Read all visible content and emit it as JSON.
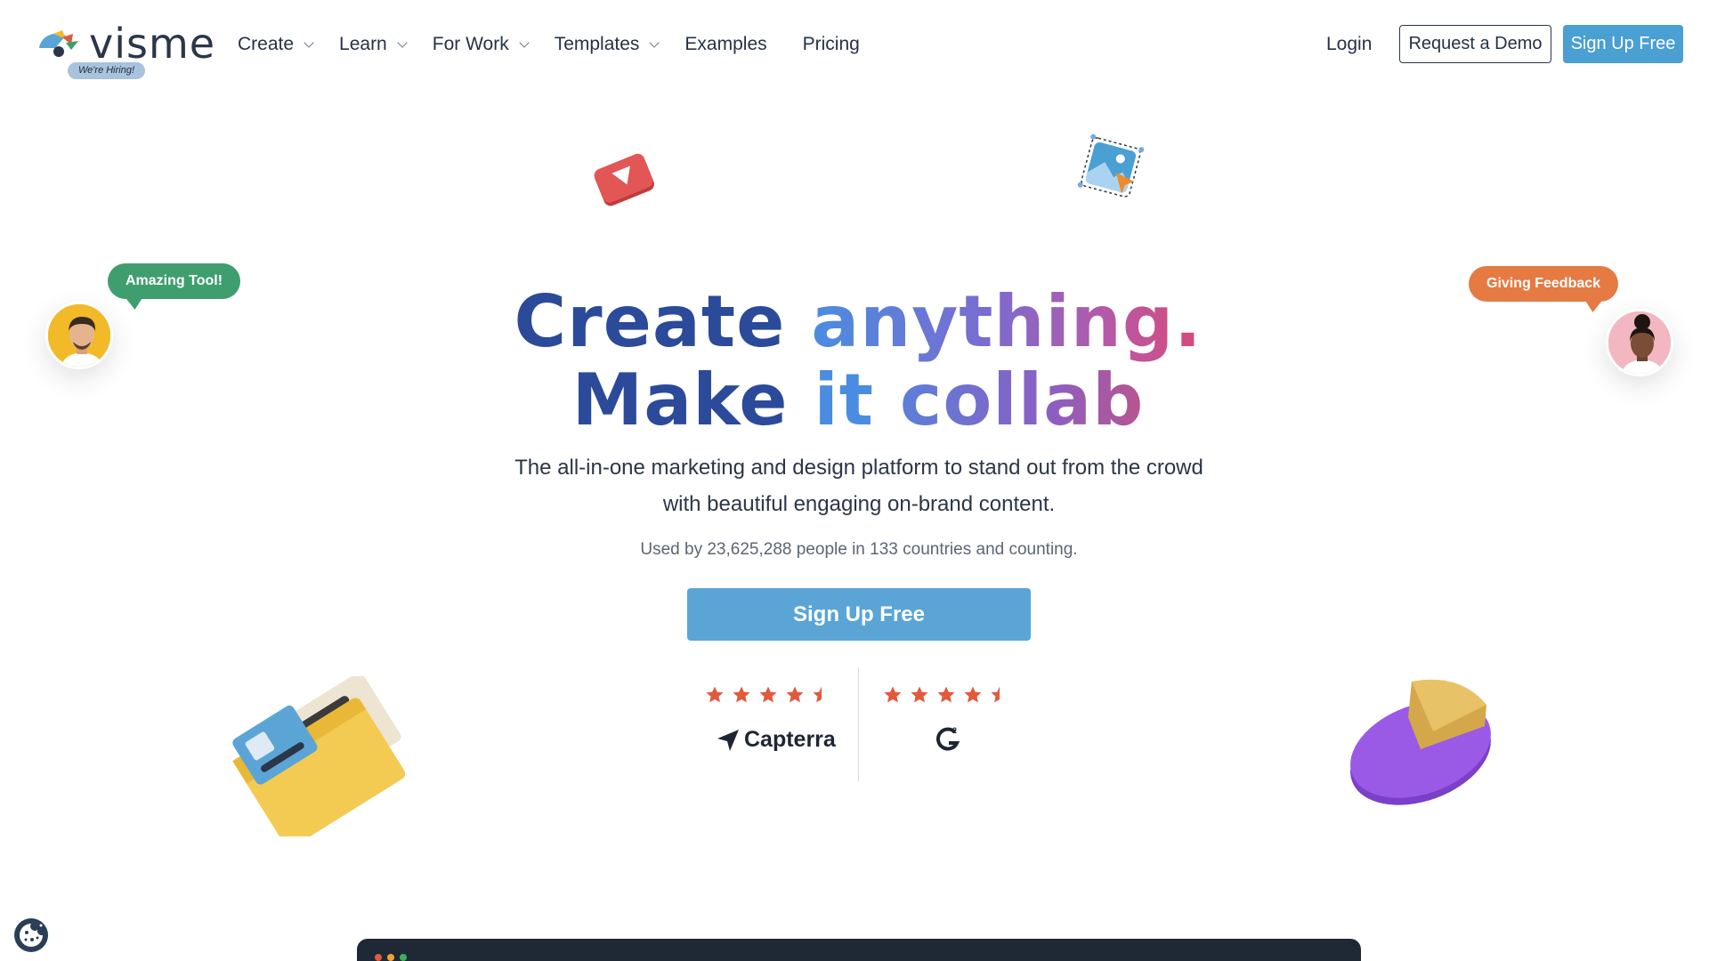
{
  "header": {
    "logo_text": "visme",
    "hiring_badge": "We're Hiring!",
    "nav": [
      {
        "label": "Create",
        "dropdown": true
      },
      {
        "label": "Learn",
        "dropdown": true
      },
      {
        "label": "For Work",
        "dropdown": true
      },
      {
        "label": "Templates",
        "dropdown": true
      },
      {
        "label": "Examples",
        "dropdown": false
      },
      {
        "label": "Pricing",
        "dropdown": false
      }
    ],
    "login": "Login",
    "request_demo": "Request a Demo",
    "signup": "Sign Up Free"
  },
  "hero": {
    "title_line1_a": "Create",
    "title_line1_b": "anything.",
    "title_line2_a": "Make it",
    "title_line2_b": "collab",
    "subtitle": "The all-in-one marketing and design platform to stand out from the crowd with beautiful engaging on-brand content.",
    "used_by": "Used by 23,625,288 people in 133 countries and counting.",
    "cta": "Sign Up Free"
  },
  "ratings": [
    {
      "source": "Capterra",
      "stars": 4.5
    },
    {
      "source": "G2",
      "stars": 4.5
    }
  ],
  "bubbles": {
    "left": "Amazing Tool!",
    "right": "Giving Feedback"
  },
  "colors": {
    "brand_blue": "#4a9fd3",
    "cta_blue": "#5aa5d6",
    "title_dark": "#2c4a9a",
    "star_orange": "#e25a3c",
    "bubble_green": "#3f9e6e",
    "bubble_orange": "#e57a43"
  },
  "icons": [
    "visme-logo-icon",
    "chevron-down-icon",
    "play-icon",
    "image-select-icon",
    "folder-icon",
    "pie-chart-icon",
    "star-icon",
    "capterra-icon",
    "g2-icon",
    "cookie-icon"
  ]
}
